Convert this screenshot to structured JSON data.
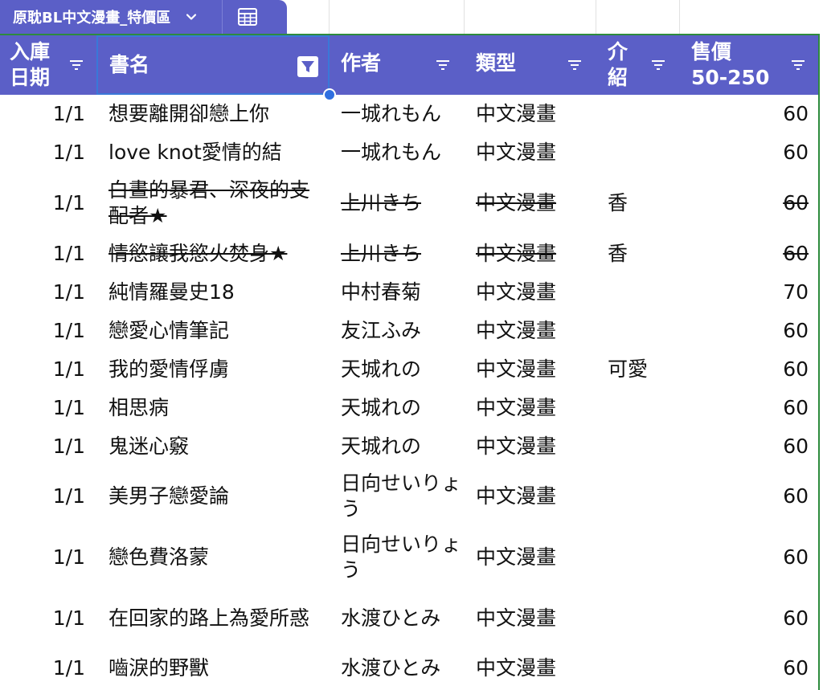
{
  "toolbar": {
    "table_name": "原耽BL中文漫畫_特價區"
  },
  "header": {
    "columns": [
      {
        "key": "date",
        "label_line1": "入庫",
        "label_line2": "日期"
      },
      {
        "key": "title",
        "label_line1": "書名",
        "label_line2": ""
      },
      {
        "key": "author",
        "label_line1": "作者",
        "label_line2": ""
      },
      {
        "key": "type",
        "label_line1": "類型",
        "label_line2": ""
      },
      {
        "key": "note",
        "label_line1": "介",
        "label_line2": "紹"
      },
      {
        "key": "price",
        "label_line1": "售價",
        "label_line2": "50-250"
      }
    ]
  },
  "rows": [
    {
      "date": "1/1",
      "title": "想要離開卻戀上你",
      "author": "一城れもん",
      "type": "中文漫畫",
      "note": "",
      "price": "60",
      "struck": false
    },
    {
      "date": "1/1",
      "title": "love knot愛情的結",
      "author": "一城れもん",
      "type": "中文漫畫",
      "note": "",
      "price": "60",
      "struck": false
    },
    {
      "date": "1/1",
      "title": "白晝的暴君、深夜的支配者★",
      "author": "上川きち",
      "type": "中文漫畫",
      "note": "香",
      "price": "60",
      "struck": true
    },
    {
      "date": "1/1",
      "title": "情慾讓我慾火焚身★",
      "author": "上川きち",
      "type": "中文漫畫",
      "note": "香",
      "price": "60",
      "struck": true
    },
    {
      "date": "1/1",
      "title": "純情羅曼史18",
      "author": "中村春菊",
      "type": "中文漫畫",
      "note": "",
      "price": "70",
      "struck": false
    },
    {
      "date": "1/1",
      "title": "戀愛心情筆記",
      "author": "友江ふみ",
      "type": "中文漫畫",
      "note": "",
      "price": "60",
      "struck": false
    },
    {
      "date": "1/1",
      "title": "我的愛情俘虜",
      "author": "天城れの",
      "type": "中文漫畫",
      "note": "可愛",
      "price": "60",
      "struck": false
    },
    {
      "date": "1/1",
      "title": "相思病",
      "author": "天城れの",
      "type": "中文漫畫",
      "note": "",
      "price": "60",
      "struck": false
    },
    {
      "date": "1/1",
      "title": "鬼迷心竅",
      "author": "天城れの",
      "type": "中文漫畫",
      "note": "",
      "price": "60",
      "struck": false
    },
    {
      "date": "1/1",
      "title": "美男子戀愛論",
      "author": "日向せいりょう",
      "type": "中文漫畫",
      "note": "",
      "price": "60",
      "struck": false
    },
    {
      "date": "1/1",
      "title": "戀色費洛蒙",
      "author": "日向せいりょう",
      "type": "中文漫畫",
      "note": "",
      "price": "60",
      "struck": false
    },
    {
      "date": "1/1",
      "title": "在回家的路上為愛所惑",
      "author": "水渡ひとみ",
      "type": "中文漫畫",
      "note": "",
      "price": "60",
      "struck": false
    },
    {
      "date": "1/1",
      "title": "嚙淚的野獸",
      "author": "水渡ひとみ",
      "type": "中文漫畫",
      "note": "",
      "price": "60",
      "struck": false
    }
  ],
  "colors": {
    "header_bg": "#5b5fc7",
    "selection": "#3a78d8",
    "frozen_line": "#2e8b3d"
  }
}
